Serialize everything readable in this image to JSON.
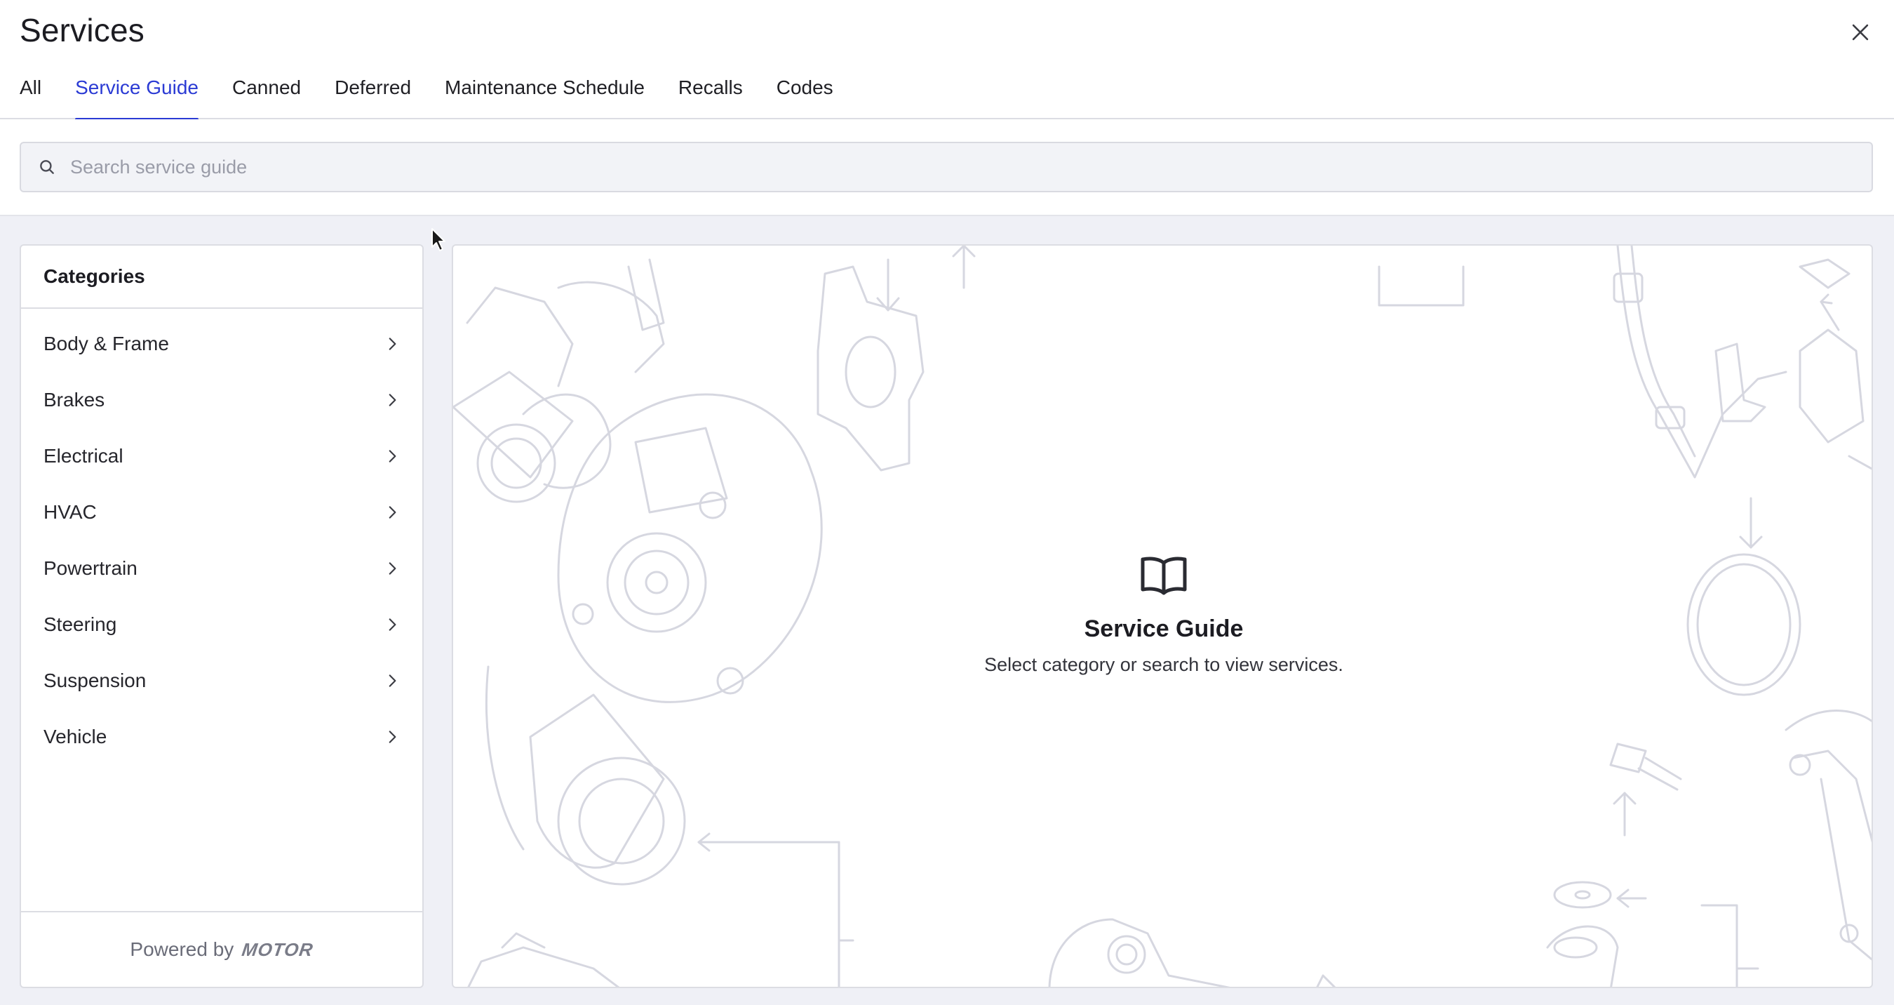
{
  "header": {
    "title": "Services",
    "close_icon": "close-icon"
  },
  "tabs": [
    {
      "label": "All",
      "active": false
    },
    {
      "label": "Service Guide",
      "active": true
    },
    {
      "label": "Canned",
      "active": false
    },
    {
      "label": "Deferred",
      "active": false
    },
    {
      "label": "Maintenance Schedule",
      "active": false
    },
    {
      "label": "Recalls",
      "active": false
    },
    {
      "label": "Codes",
      "active": false
    }
  ],
  "search": {
    "placeholder": "Search service guide",
    "value": "",
    "icon": "search-icon"
  },
  "categories": {
    "heading": "Categories",
    "items": [
      {
        "label": "Body & Frame"
      },
      {
        "label": "Brakes"
      },
      {
        "label": "Electrical"
      },
      {
        "label": "HVAC"
      },
      {
        "label": "Powertrain"
      },
      {
        "label": "Steering"
      },
      {
        "label": "Suspension"
      },
      {
        "label": "Vehicle"
      }
    ],
    "footer": {
      "powered_by": "Powered by",
      "brand": "MOTOR"
    }
  },
  "guide": {
    "icon": "book-icon",
    "title": "Service Guide",
    "subtitle": "Select category or search to view services."
  },
  "colors": {
    "accent": "#2b3bd4",
    "background": "#eff0f6",
    "border": "#dcdde3",
    "illustration": "#d6d7e0"
  }
}
